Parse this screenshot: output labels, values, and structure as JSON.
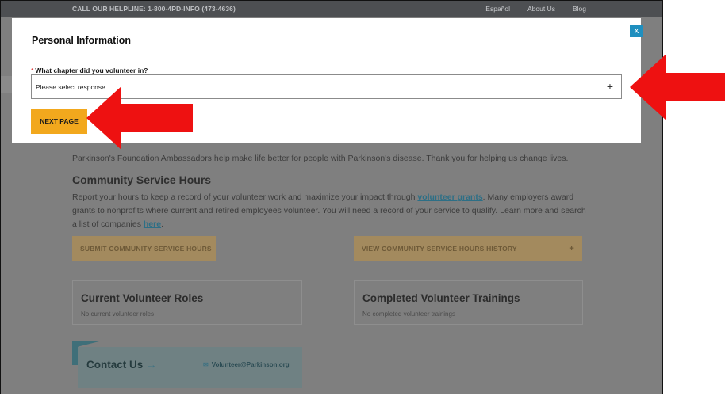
{
  "topbar": {
    "helpline": "CALL OUR HELPLINE: 1-800-4PD-INFO (473-4636)",
    "links": [
      "Español",
      "About Us",
      "Blog"
    ]
  },
  "modal": {
    "title": "Personal Information",
    "required_marker": "*",
    "question": "What chapter did you volunteer in?",
    "select_value": "Please select response",
    "select_icon": "+",
    "next_button": "NEXT PAGE",
    "close_label": "x"
  },
  "page": {
    "intro": "Parkinson's Foundation Ambassadors help make life better for people with Parkinson's disease. Thank you for helping us change lives.",
    "service_heading": "Community Service Hours",
    "service_text_1": "Report your hours to keep a record of your volunteer work and maximize your impact through ",
    "service_link_1": "volunteer grants",
    "service_text_2": ". Many employers award grants to nonprofits where current and retired employees volunteer. You will need a record of your service to qualify. Learn more and search a list of companies ",
    "service_link_2": "here",
    "service_text_3": ".",
    "submit_hours_button": "SUBMIT COMMUNITY SERVICE HOURS",
    "history_button": "VIEW COMMUNITY SERVICE HOURS HISTORY",
    "history_icon": "+",
    "roles_title": "Current Volunteer Roles",
    "roles_empty": "No current volunteer roles",
    "trainings_title": "Completed Volunteer Trainings",
    "trainings_empty": "No completed volunteer trainings",
    "contact_title": "Contact Us",
    "contact_arrow": "→",
    "contact_email": "Volunteer@Parkinson.org"
  },
  "colors": {
    "accent_button": "#f2a81d",
    "close_button": "#1f8fbf",
    "annotation_arrow": "#ee1111"
  }
}
